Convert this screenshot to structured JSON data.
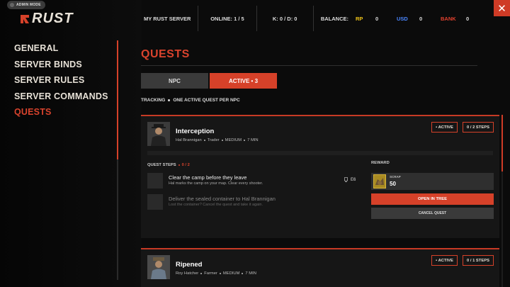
{
  "admin": {
    "label": "ADMIN MODE"
  },
  "logo": {
    "text": "RUST"
  },
  "topbar": {
    "server": "MY RUST SERVER",
    "online": "ONLINE: 1 / 5",
    "kd": "K: 0 / D: 0",
    "balance_label": "BALANCE:",
    "rp_label": "RP",
    "rp_value": "0",
    "usd_label": "USD",
    "usd_value": "0",
    "bank_label": "BANK",
    "bank_value": "0"
  },
  "close": {
    "glyph": "✕"
  },
  "nav": {
    "items": [
      {
        "label": "GENERAL"
      },
      {
        "label": "SERVER BINDS"
      },
      {
        "label": "SERVER RULES"
      },
      {
        "label": "SERVER COMMANDS"
      },
      {
        "label": "QUESTS"
      }
    ],
    "active": "QUESTS"
  },
  "page": {
    "title": "QUESTS"
  },
  "tabs": {
    "npc": "NPC",
    "active": "ACTIVE • 3"
  },
  "tracking": {
    "label": "TRACKING",
    "text": "ONE ACTIVE QUEST PER NPC"
  },
  "quests": [
    {
      "name": "Interception",
      "npc": "Hal Brannigan",
      "role": "Trader",
      "difficulty": "MEDIUM",
      "duration": "7 MIN",
      "status": "• ACTIVE",
      "steps_badge": "0 / 2 STEPS",
      "steps_label": "QUEST STEPS",
      "steps_count": "0 / 2",
      "steps": [
        {
          "title": "Clear the camp before they leave",
          "desc": "Hal marks the camp on your map. Clear every shooter.",
          "location": "E6"
        },
        {
          "title": "Deliver the sealed container to Hal Brannigan",
          "desc": "Lost the container? Cancel the quest and take it again."
        }
      ],
      "reward_label": "REWARD",
      "reward_item": "SCRAP",
      "reward_qty": "50",
      "open_button": "OPEN IN TREE",
      "cancel_button": "CANCEL QUEST"
    },
    {
      "name": "Ripened",
      "npc": "Roy Hatcher",
      "role": "Farmer",
      "difficulty": "MEDIUM",
      "duration": "7 MIN",
      "status": "• ACTIVE",
      "steps_badge": "0 / 1 STEPS"
    }
  ],
  "colors": {
    "accent": "#d64129",
    "rp": "#f0c419",
    "usd": "#4a86ff",
    "bank": "#e2412e"
  }
}
